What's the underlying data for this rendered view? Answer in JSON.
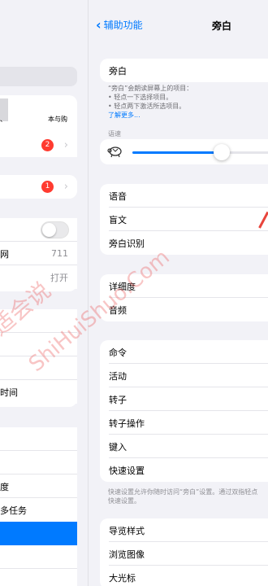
{
  "left_panel": {
    "row_account_text": "本与购",
    "row_badge_1": {
      "count": "2"
    },
    "row_badge_2": {
      "count": "1"
    },
    "row_wifi": {
      "label": "网",
      "value": "711"
    },
    "row_bluetooth": {
      "value": "打开"
    },
    "row_screen_time": {
      "label": "时间"
    },
    "row_display": {
      "label": "度"
    },
    "row_multitask": {
      "label": "多任务"
    }
  },
  "nav": {
    "back_label": "辅助功能",
    "title": "旁白"
  },
  "voiceover": {
    "toggle_label": "旁白",
    "description": "“旁白”会朗读屏幕上的项目：",
    "bullets": [
      "• 轻点一下选择项目。",
      "• 轻点两下激活所选项目。"
    ],
    "learn_more": "了解更多...",
    "speaking_rate_label": "语速",
    "speaking_rate": 0.58
  },
  "group_speech": [
    "语音",
    "盲文",
    "旁白识别"
  ],
  "group_verbosity": [
    "详细度",
    "音频"
  ],
  "group_commands": [
    "命令",
    "活动",
    "转子",
    "转子操作",
    "键入",
    "快速设置"
  ],
  "quick_settings_footnote": "快速设置允许你随时访问“旁白”设置。通过双指轻点",
  "quick_settings_footnote_2": "快速设置。",
  "group_navigation": [
    "导览样式",
    "浏览图像",
    "大光标"
  ],
  "watermark": {
    "line1": "适会说",
    "line2": "ShiHuiShuo.Com"
  }
}
